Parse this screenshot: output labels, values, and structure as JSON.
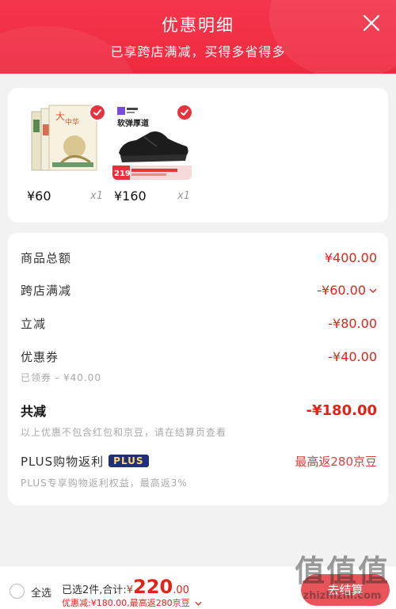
{
  "header": {
    "title": "优惠明细",
    "subtitle": "已享跨店满减，买得多省得多"
  },
  "products": [
    {
      "thumb": "book-set-thumbnail",
      "price": "¥60",
      "qty": "x1",
      "selected": true
    },
    {
      "thumb": "black-sneaker-thumbnail",
      "price": "¥160",
      "qty": "x1",
      "selected": true,
      "banner_text": "软弹厚道",
      "promo_price": "219"
    }
  ],
  "detail": {
    "total_goods": {
      "label": "商品总额",
      "value": "¥400.00"
    },
    "cross_store": {
      "label": "跨店满减",
      "value": "-¥60.00"
    },
    "instant": {
      "label": "立减",
      "value": "-¥80.00"
    },
    "coupon": {
      "label": "优惠券",
      "value": "-¥40.00",
      "note": "已领券 - ¥40.00"
    },
    "total_discount": {
      "label": "共减",
      "value": "-¥180.00",
      "note": "以上优惠不包含红包和京豆，请在结算页查看"
    },
    "plus": {
      "label": "PLUS购物返利",
      "badge": "PLUS",
      "value": "最高返280京豆",
      "note": "PLUS专享购物返利权益，最高返3%"
    }
  },
  "bottom": {
    "select_all": "全选",
    "selected_prefix": "已选2件,合计:",
    "amount_sign": "¥",
    "amount_int": "220",
    "amount_dec": ".00",
    "discount_line": "优惠减:¥180.00,最高返280京豆",
    "checkout_label": "去结算"
  },
  "watermark": {
    "big": "值值值",
    "small": "zhizhizhi.com"
  },
  "colors": {
    "accent": "#e2231a",
    "header": "#f4364c",
    "plus_badge": "#1f2f7a"
  }
}
